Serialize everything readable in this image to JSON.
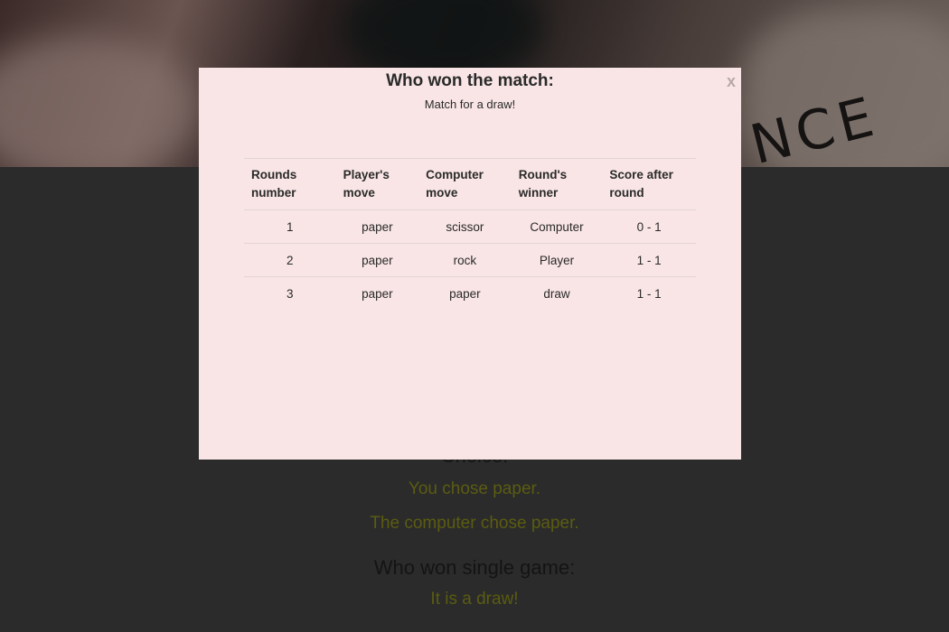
{
  "background": {
    "hero_text": "NCE",
    "choice_heading": "Choice:",
    "player_choice": "You chose paper.",
    "computer_choice": "The computer chose paper.",
    "single_game_heading": "Who won single game:",
    "single_game_result": "It is a draw!"
  },
  "modal": {
    "title": "Who won the match:",
    "subtitle": "Match for a draw!",
    "close_label": "x",
    "table": {
      "headers": [
        "Rounds number",
        "Player's move",
        "Computer move",
        "Round's winner",
        "Score after round"
      ],
      "rows": [
        [
          "1",
          "paper",
          "scissor",
          "Computer",
          "0 - 1"
        ],
        [
          "2",
          "paper",
          "rock",
          "Player",
          "1 - 1"
        ],
        [
          "3",
          "paper",
          "paper",
          "draw",
          "1 - 1"
        ]
      ]
    }
  },
  "colors": {
    "modal_bg": "#f9e5e5",
    "page_bg": "#2b2b2b",
    "olive_text": "#5b5c11"
  }
}
